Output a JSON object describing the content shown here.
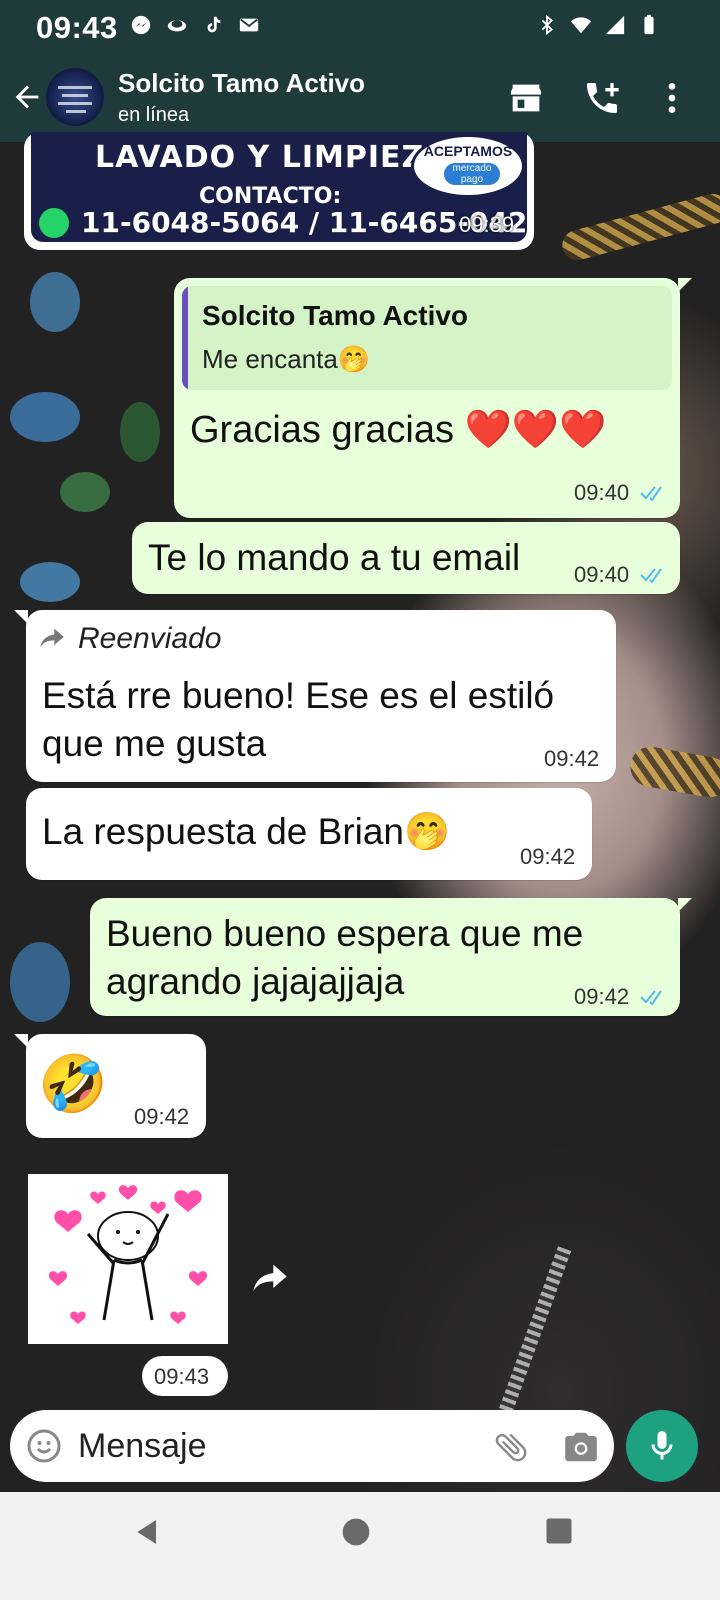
{
  "status_bar": {
    "time": "09:43",
    "left_icons": [
      "messenger-icon",
      "sparkle-icon",
      "tiktok-icon",
      "gmail-icon"
    ],
    "right_icons": [
      "bluetooth-icon",
      "wifi-icon",
      "signal-icon",
      "battery-icon"
    ]
  },
  "header": {
    "contact_name": "Solcito Tamo Activo",
    "status": "en línea"
  },
  "banner": {
    "title": "LAVADO Y LIMPIEZA",
    "badge_title": "ACEPTAMOS",
    "badge_sub": "mercado pago",
    "contact_label": "CONTACTO:",
    "phones": "11-6048-5064 / 11-6465-0422",
    "time": "09:39"
  },
  "messages": [
    {
      "quote_name": "Solcito Tamo Activo",
      "quote_text": "Me encanta🤭",
      "text": "Gracias gracias ❤️❤️❤️",
      "time": "09:40"
    },
    {
      "text": "Te lo mando a tu email",
      "time": "09:40"
    },
    {
      "forward_label": "Reenviado",
      "line1": "Está rre bueno! Ese es el estiló",
      "line2": "que me gusta",
      "time": "09:42"
    },
    {
      "text": "La respuesta de Brian🤭",
      "time": "09:42"
    },
    {
      "line1": "Bueno bueno espera que me",
      "line2": "agrando jajajajjaja",
      "time": "09:42"
    },
    {
      "text": "🤣",
      "time": "09:42"
    },
    {
      "time": "09:43"
    }
  ],
  "input": {
    "placeholder": "Mensaje"
  },
  "colors": {
    "header": "#1f3a3a",
    "outgoing": "#e7ffdb",
    "incoming": "#ffffff",
    "read_ticks": "#53bdeb",
    "mic": "#1ea181"
  }
}
